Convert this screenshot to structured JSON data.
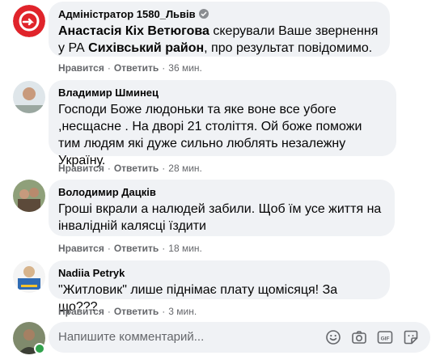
{
  "comments": [
    {
      "author": "Адміністратор 1580_Львів",
      "verified": true,
      "text_parts": [
        "Анастасія Кіх Ветюгова",
        " скерували Ваше звернення у РА ",
        "Сихівський район",
        ", про результат повідомимо."
      ],
      "like_label": "Нравится",
      "reply_label": "Ответить",
      "time": "36 мин."
    },
    {
      "author": "Владимир Шминец",
      "text": "Господи Боже людоньки та яке воне все убоге ,несщасне . На дворі 21 століття. Ой боже поможи тим людям які дуже сильно люблять незалежну Україну.",
      "like_label": "Нравится",
      "reply_label": "Ответить",
      "time": "28 мин."
    },
    {
      "author": "Володимир Дацків",
      "text": "Гроші вкрали а налюдей забили. Щоб їм усе життя на інвалідній калясці їздити",
      "like_label": "Нравится",
      "reply_label": "Ответить",
      "time": "18 мин."
    },
    {
      "author": "Nadiia Petryk",
      "text": "\"Житловик\" лише піднімає плату щомісяця! За що???",
      "like_label": "Нравится",
      "reply_label": "Ответить",
      "time": "3 мин."
    }
  ],
  "composer": {
    "placeholder": "Напишите комментарий...",
    "icons": [
      "emoji-icon",
      "camera-icon",
      "gif-icon",
      "sticker-icon"
    ]
  },
  "colors": {
    "bubble": "#f0f2f5",
    "meta": "#65676b",
    "brand_red": "#e0242b",
    "online": "#31a24c"
  }
}
